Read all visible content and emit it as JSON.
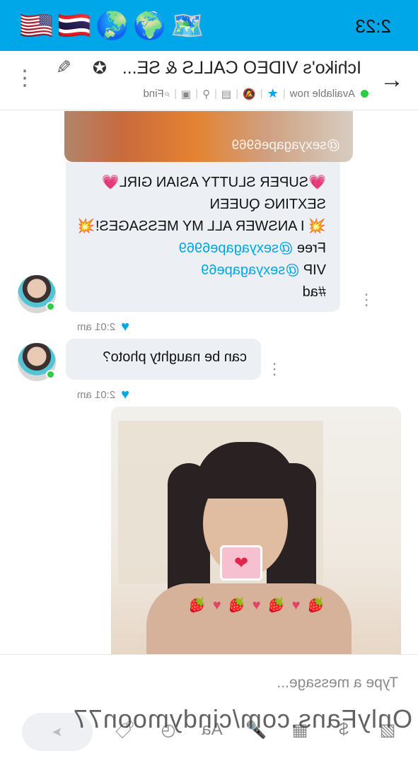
{
  "status": {
    "time": "2:23",
    "icons": [
      "🗺️",
      "🌍",
      "🌏",
      "🇹🇭",
      "🇺🇸"
    ]
  },
  "header": {
    "title": "Ichiko's VIDEO CALLS & SE...",
    "availability": "Available now",
    "find_label": "Find"
  },
  "messages": {
    "image_watermark": "@sexyagape6969",
    "promo": {
      "line1": "💗SUPER SLUTTY ASIAN GIRL💗",
      "line2": "SEXTING QUEEN",
      "line3": "💥 I ANSWER ALL MY MESSAGES!💥",
      "free_label": "Free ",
      "free_link": "@sexyagape6969",
      "vip_label": "VIP ",
      "vip_link": "@sexyagape69",
      "tag": "#ad",
      "time": "2:01 am"
    },
    "reply": {
      "text": "can be naughty photo?",
      "time": "2:01 am"
    },
    "photo_sticker": "❤"
  },
  "composer": {
    "placeholder": "Type a message...",
    "watermark": "OnlyFans.com/cindymoon77"
  },
  "colors": {
    "accent": "#00a7e8",
    "online": "#2ecc40"
  }
}
